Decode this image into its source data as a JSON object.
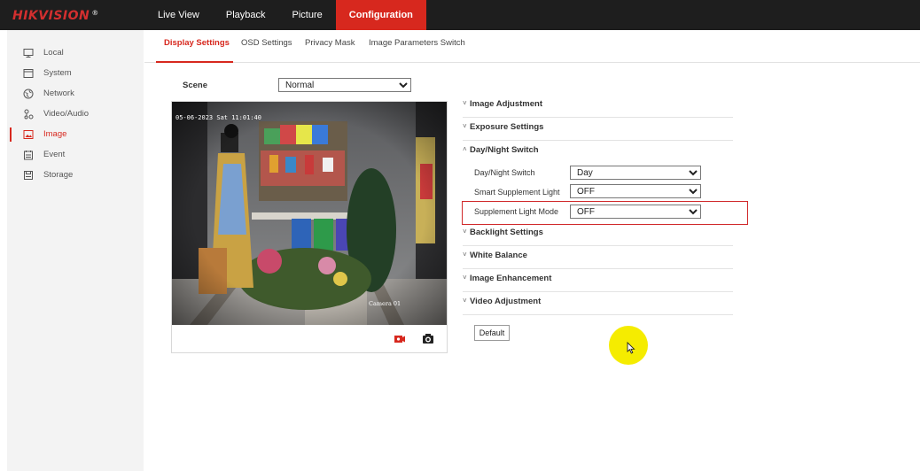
{
  "brand": {
    "name": "HIKVISION",
    "reg": "®"
  },
  "nav": [
    {
      "label": "Live View"
    },
    {
      "label": "Playback"
    },
    {
      "label": "Picture"
    },
    {
      "label": "Configuration"
    }
  ],
  "sidebar": {
    "items": [
      {
        "label": "Local",
        "icon": "monitor-icon"
      },
      {
        "label": "System",
        "icon": "window-icon"
      },
      {
        "label": "Network",
        "icon": "globe-icon"
      },
      {
        "label": "Video/Audio",
        "icon": "media-icon"
      },
      {
        "label": "Image",
        "icon": "image-icon"
      },
      {
        "label": "Event",
        "icon": "calendar-icon"
      },
      {
        "label": "Storage",
        "icon": "storage-icon"
      }
    ]
  },
  "tabs": [
    {
      "label": "Display Settings"
    },
    {
      "label": "OSD Settings"
    },
    {
      "label": "Privacy Mask"
    },
    {
      "label": "Image Parameters Switch"
    }
  ],
  "scene": {
    "label": "Scene",
    "value": "Normal"
  },
  "video": {
    "timestamp": "05-06-2023 Sat 11:01:40",
    "camera": "Camera 01"
  },
  "sections": {
    "image_adjustment": "Image Adjustment",
    "exposure": "Exposure Settings",
    "day_night": "Day/Night Switch",
    "backlight": "Backlight Settings",
    "white_balance": "White Balance",
    "enhancement": "Image Enhancement",
    "video_adjustment": "Video Adjustment"
  },
  "daynight": {
    "switch_label": "Day/Night Switch",
    "switch_value": "Day",
    "smart_label": "Smart Supplement Light",
    "smart_value": "OFF",
    "mode_label": "Supplement Light Mode",
    "mode_value": "OFF"
  },
  "default_button": "Default",
  "colors": {
    "accent": "#d7281e",
    "topbar": "#1e1e1e",
    "highlight": "#d0282a",
    "cursor_halo": "#f5ec00"
  }
}
